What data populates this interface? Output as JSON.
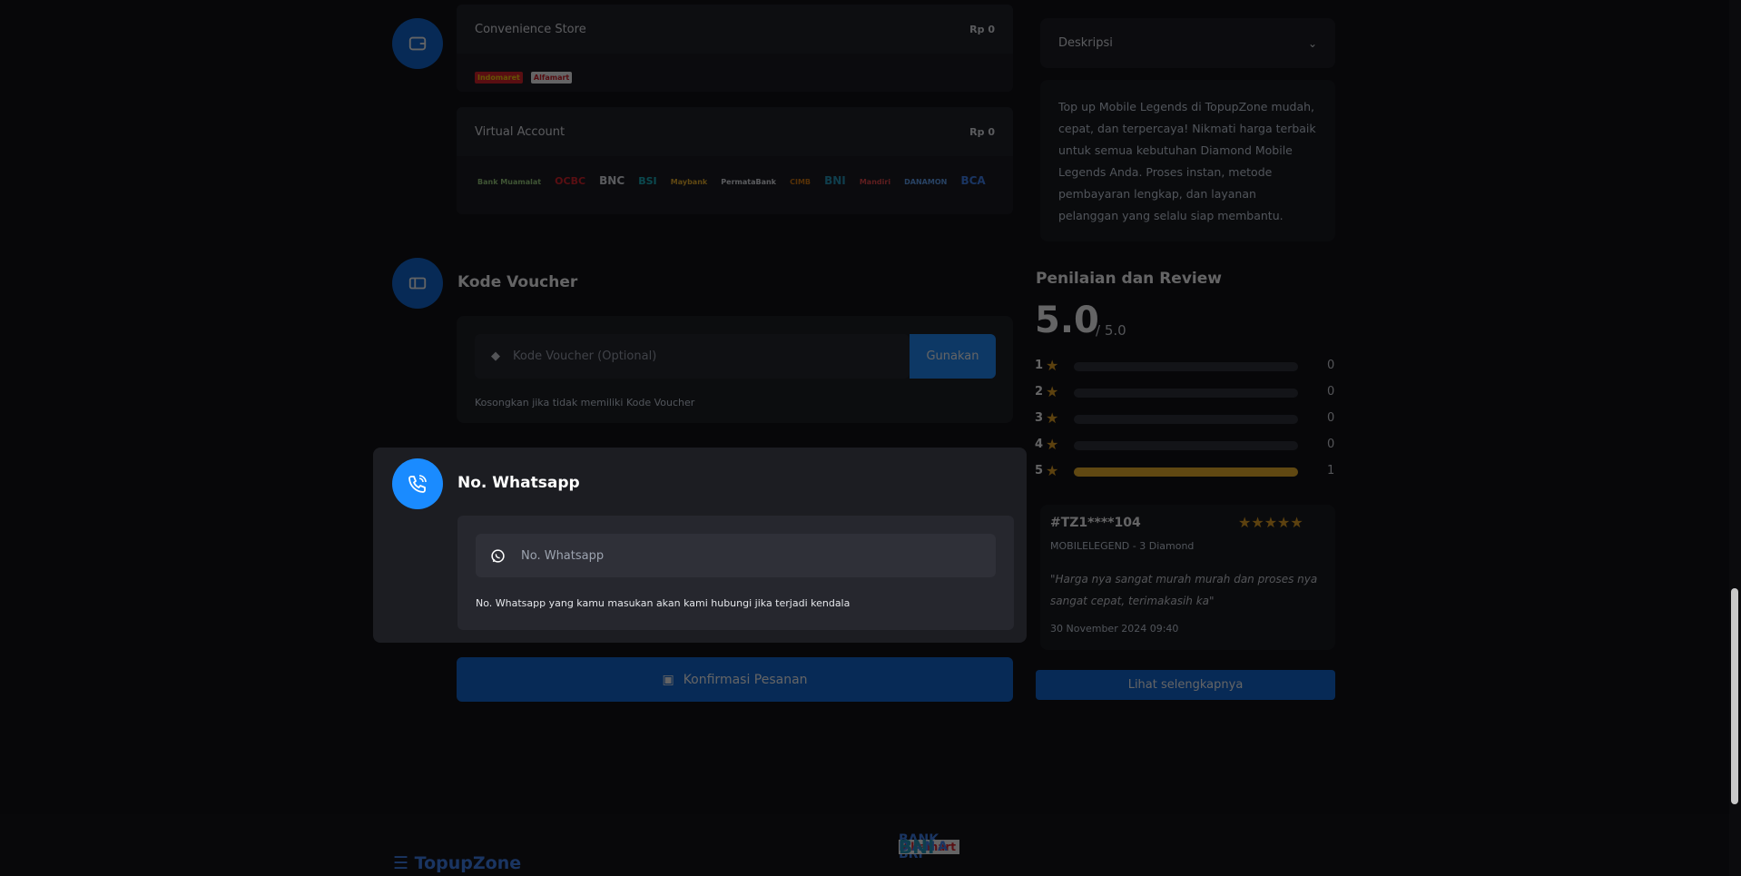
{
  "payment": {
    "convenience_store": {
      "label": "Convenience Store",
      "price": "Rp 0",
      "logos": [
        "Indomaret",
        "Alfamart"
      ]
    },
    "virtual_account": {
      "label": "Virtual Account",
      "price": "Rp 0",
      "logos": [
        "Bank Muamalat",
        "OCBC",
        "BNC",
        "BSI",
        "Maybank",
        "PermataBank",
        "CIMB",
        "BNI",
        "Mandiri",
        "DANAMON",
        "BCA"
      ]
    }
  },
  "voucher": {
    "title": "Kode Voucher",
    "placeholder": "Kode Voucher (Optional)",
    "button": "Gunakan",
    "hint": "Kosongkan jika tidak memiliki Kode Voucher"
  },
  "whatsapp": {
    "title": "No. Whatsapp",
    "placeholder": "No. Whatsapp",
    "hint": "No. Whatsapp yang kamu masukan akan kami hubungi jika terjadi kendala"
  },
  "confirm_button": "Konfirmasi Pesanan",
  "description": {
    "label": "Deskripsi",
    "text": "Top up Mobile Legends di TopupZone mudah, cepat, dan terpercaya! Nikmati harga terbaik untuk semua kebutuhan Diamond Mobile Legends Anda. Proses instan, metode pembayaran lengkap, dan layanan pelanggan yang selalu siap membantu."
  },
  "reviews": {
    "title": "Penilaian dan Review",
    "score": "5.0",
    "score_max": "/ 5.0",
    "ratings": [
      {
        "stars": "1",
        "count": "0",
        "fraction": 0
      },
      {
        "stars": "2",
        "count": "0",
        "fraction": 0
      },
      {
        "stars": "3",
        "count": "0",
        "fraction": 0
      },
      {
        "stars": "4",
        "count": "0",
        "fraction": 0
      },
      {
        "stars": "5",
        "count": "1",
        "fraction": 1
      }
    ],
    "item": {
      "user": "#TZ1****104",
      "product": "MOBILELEGEND - 3 Diamond",
      "comment": "\"Harga nya sangat murah murah dan proses nya sangat cepat, terimakasih ka\"",
      "date": "30 November 2024 09:40",
      "stars": 5
    },
    "more_button": "Lihat selengkapnya"
  },
  "footer": {
    "brand": "TopupZone",
    "partners": [
      "BANK BRI",
      "QRIS",
      "Alfamart",
      "DANA",
      "BNI"
    ]
  },
  "colors": {
    "accent": "#1a8bff",
    "accent_dark": "#0a66d6",
    "star": "#f5b524"
  }
}
